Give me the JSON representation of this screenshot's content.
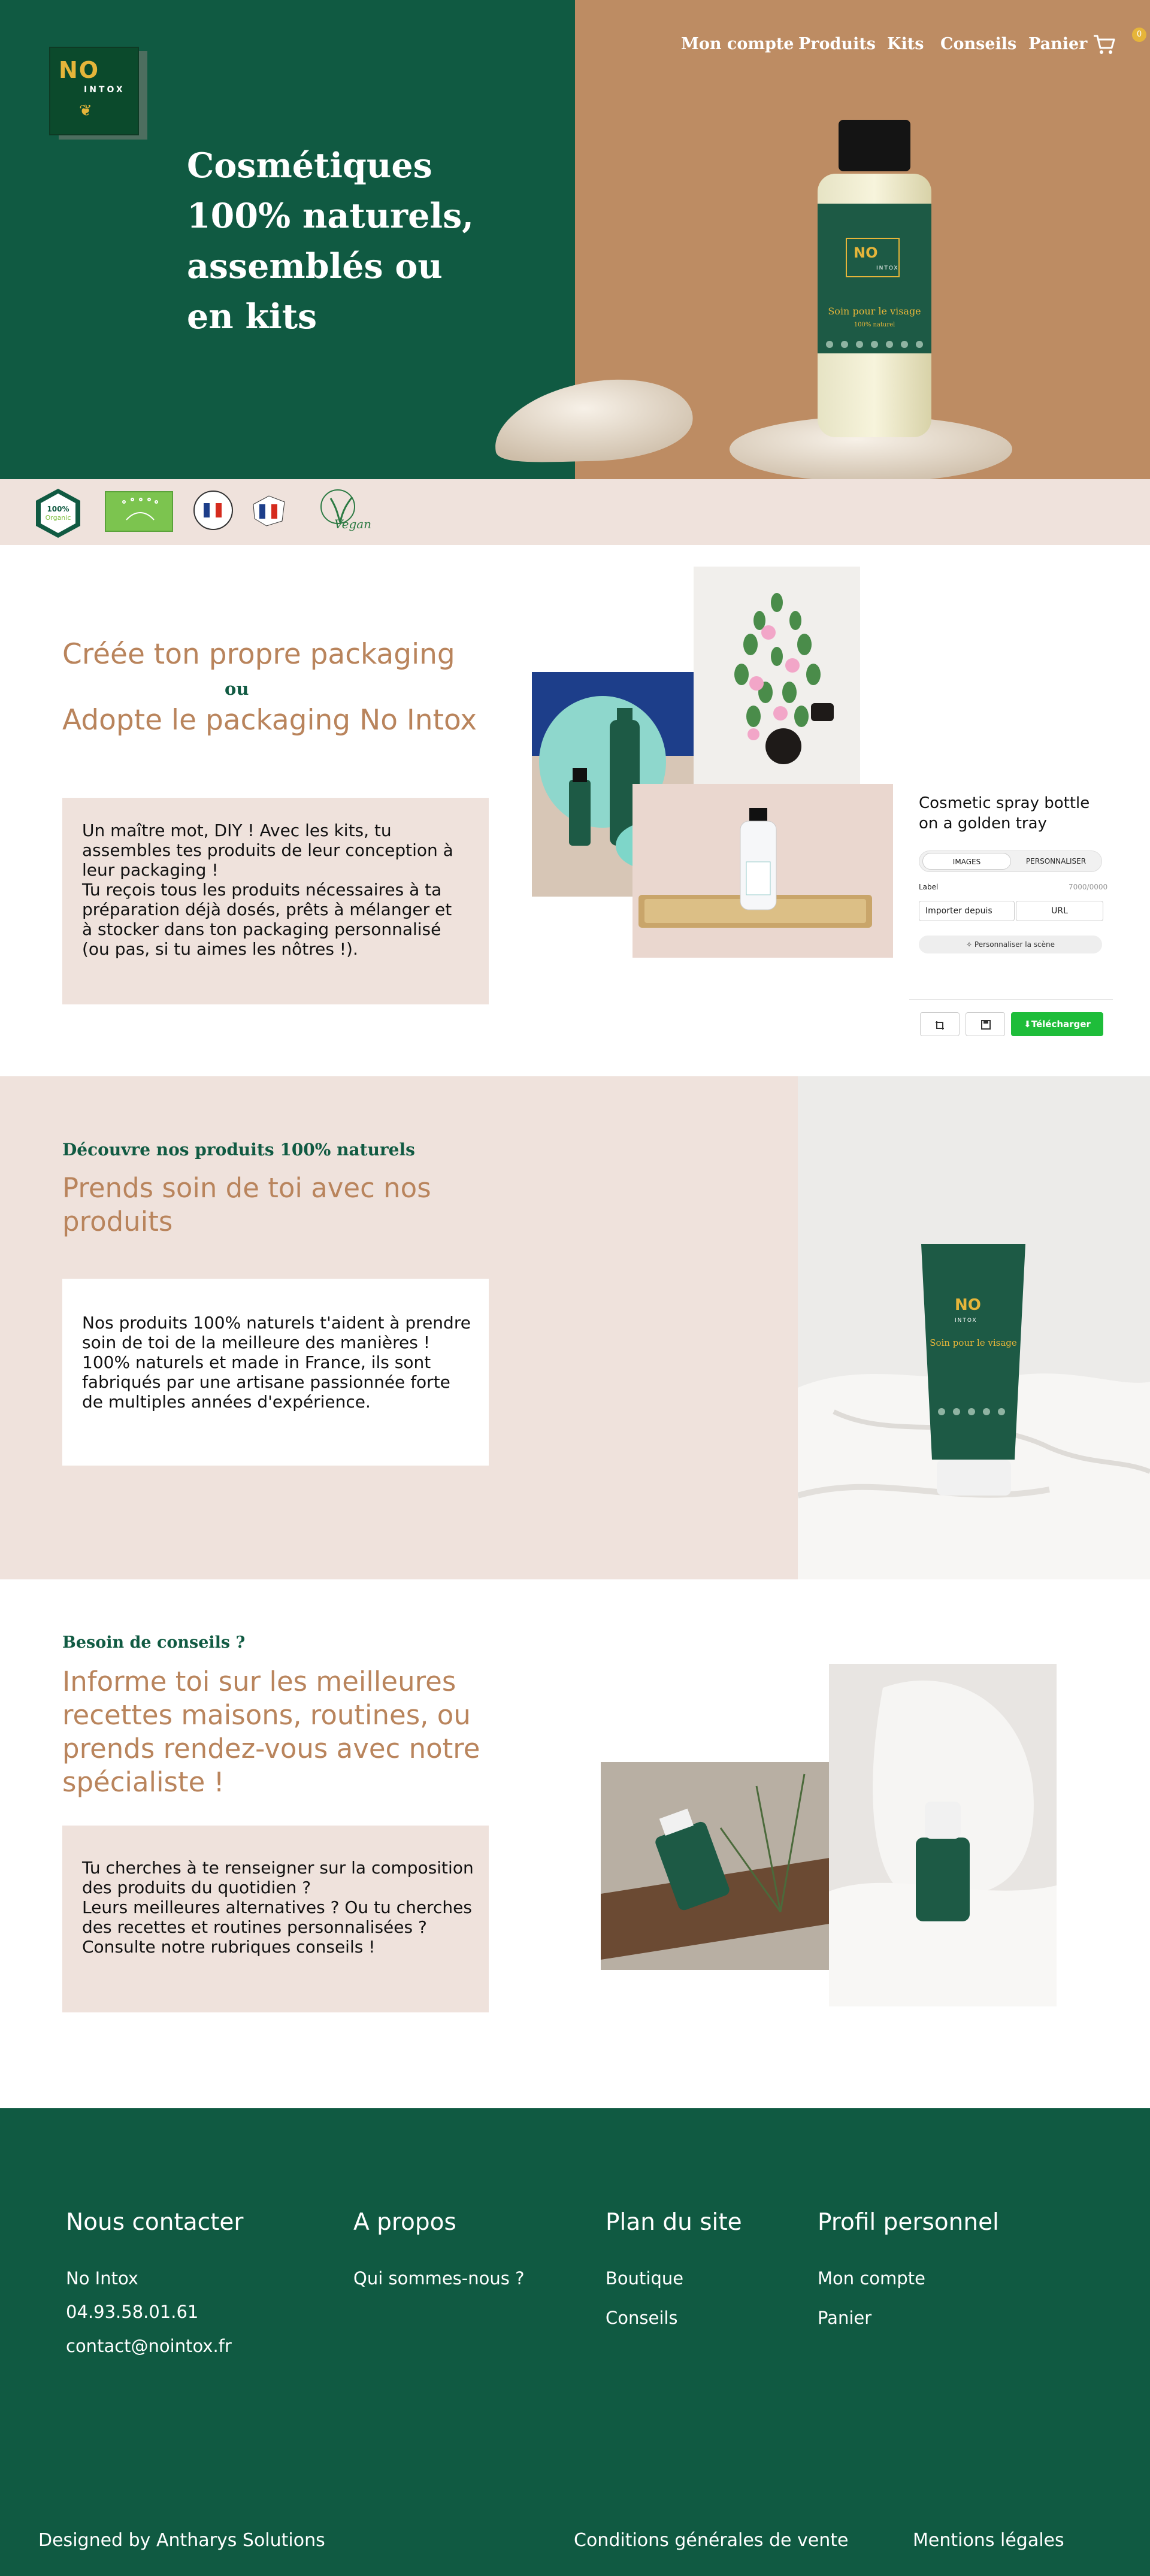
{
  "brand": {
    "logo_no": "NO",
    "logo_intox": "INTOX",
    "colors": {
      "green": "#105a42",
      "tan": "#bd8c63",
      "beige": "#efe2dc",
      "accent_text": "#b9845c",
      "gold": "#e6b53a",
      "download_green": "#1ebd3a"
    }
  },
  "nav": {
    "items": [
      "Mon compte",
      "Produits",
      "Kits",
      "Conseils",
      "Panier"
    ],
    "cart_icon": "cart-icon",
    "cart_count": "0"
  },
  "hero": {
    "title_lines": [
      "Cosmétiques",
      "100% naturels,",
      "assemblés ou",
      "en kits"
    ],
    "bottle_label": "Soin pour le visage",
    "bottle_sub": "100% naturel"
  },
  "labels": [
    "100% Organic",
    "EU organic leaf",
    "Fabriqué en France",
    "France",
    "Vegan"
  ],
  "section_diy": {
    "title": "Créée ton propre packaging",
    "ou": "ou",
    "subtitle": "Adopte le packaging No Intox",
    "text": "Un maître mot, DIY ! Avec les kits, tu assembles tes produits de leur conception à leur packaging !\nTu reçois tous les produits nécessaires à ta préparation déjà dosés, prêts à mélanger et à stocker dans ton packaging personnalisé (ou pas, si tu aimes les nôtres !)."
  },
  "editor": {
    "title": "Cosmetic spray bottle on a golden tray",
    "tabs": [
      "IMAGES",
      "PERSONNALISER"
    ],
    "label": "Label",
    "label_count": "7000/0000",
    "import": "Importer depuis",
    "url": "URL",
    "scene_button": "Personnaliser la scène",
    "download": "Télécharger"
  },
  "section_products": {
    "kicker": "Découvre nos produits 100% naturels",
    "title": "Prends soin de toi avec nos produits",
    "text": "Nos produits 100% naturels t'aident à prendre soin de toi de la meilleure des manières !\n100% naturels et made in France, ils sont fabriqués par une artisane passionnée forte de multiples années d'expérience.",
    "tube_label": "Soin pour le visage"
  },
  "section_advice": {
    "kicker": "Besoin de conseils ?",
    "title": "Informe toi sur les meilleures recettes maisons, routines, ou prends rendez-vous avec notre spécialiste !",
    "text": "Tu cherches à te renseigner sur la composition des produits du quotidien ?\nLeurs meilleures alternatives ? Ou tu cherches des recettes et routines personnalisées ?\nConsulte notre rubriques conseils !"
  },
  "footer": {
    "contact": {
      "heading": "Nous contacter",
      "lines": [
        "No Intox",
        "04.93.58.01.61",
        "contact@nointox.fr"
      ]
    },
    "about": {
      "heading": "A propos",
      "lines": [
        "Qui sommes-nous ?"
      ]
    },
    "sitemap": {
      "heading": "Plan du site",
      "lines": [
        "Boutique",
        "Conseils"
      ]
    },
    "profile": {
      "heading": "Profil  personnel",
      "lines": [
        "Mon compte",
        "Panier"
      ]
    },
    "credit": "Designed by Antharys Solutions",
    "cgv": "Conditions générales de vente",
    "legal": "Mentions légales"
  }
}
